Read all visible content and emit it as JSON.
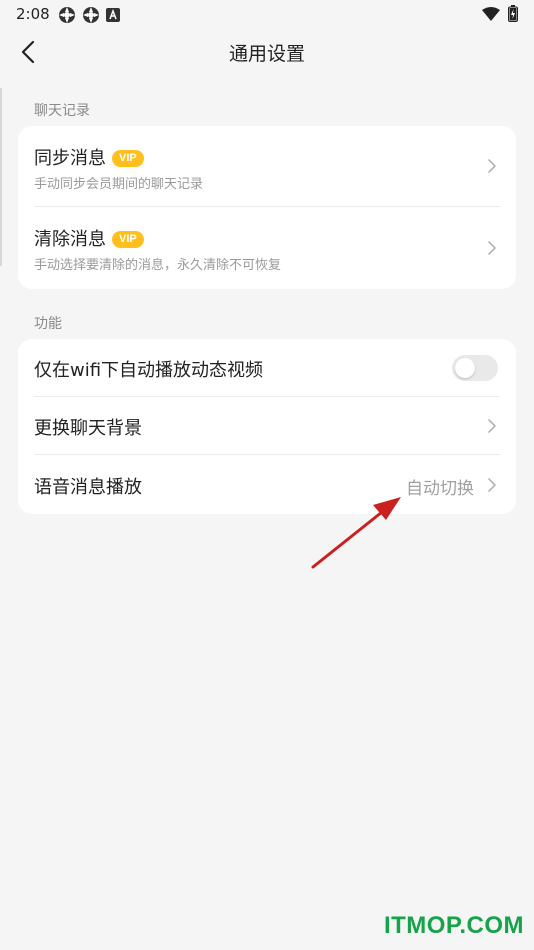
{
  "status_bar": {
    "time": "2:08"
  },
  "header": {
    "title": "通用设置"
  },
  "sections": [
    {
      "title": "聊天记录",
      "items": [
        {
          "title": "同步消息",
          "badge": "VIP",
          "subtitle": "手动同步会员期间的聊天记录"
        },
        {
          "title": "清除消息",
          "badge": "VIP",
          "subtitle": "手动选择要清除的消息，永久清除不可恢复"
        }
      ]
    },
    {
      "title": "功能",
      "items": [
        {
          "title": "仅在wifi下自动播放动态视频",
          "toggle_on": false
        },
        {
          "title": "更换聊天背景"
        },
        {
          "title": "语音消息播放",
          "value": "自动切换"
        }
      ]
    }
  ],
  "watermark": "ITMOP.COM",
  "colors": {
    "vip": "#ffbf1f",
    "annotation_arrow": "#cc1f1f",
    "watermark": "#16a34a"
  }
}
